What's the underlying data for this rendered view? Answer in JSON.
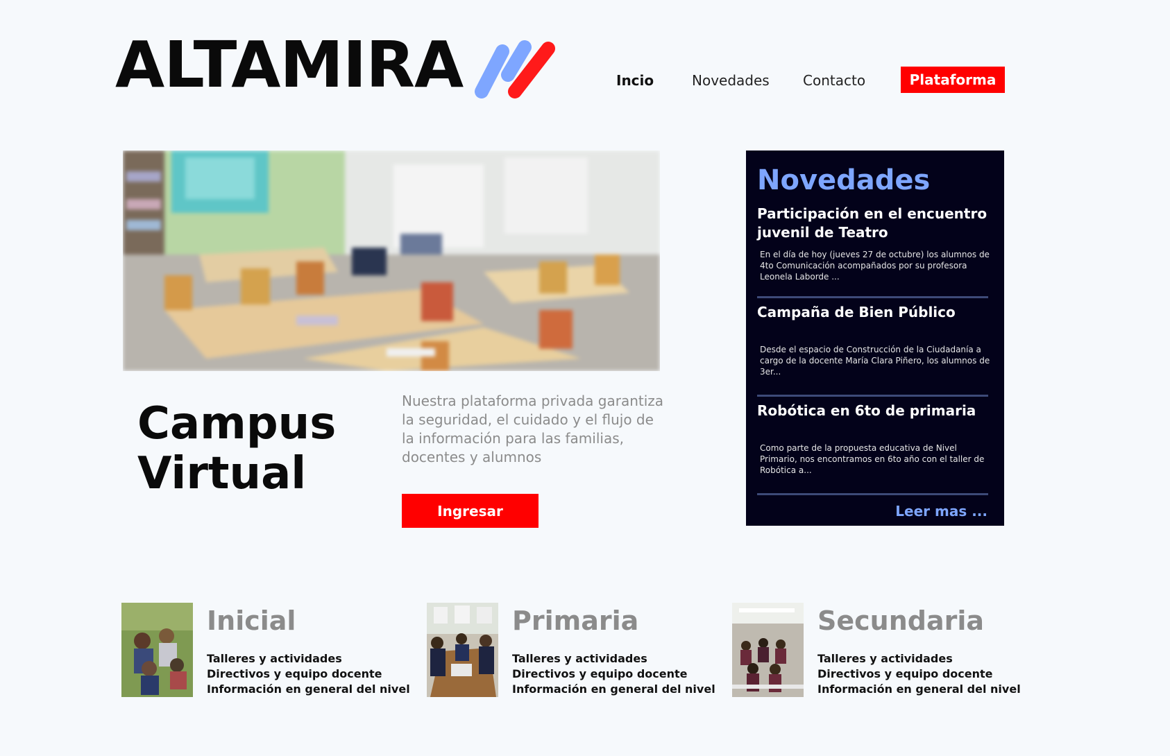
{
  "header": {
    "brand": "ALTAMIRA",
    "nav": [
      "Incio",
      "Novedades",
      "Contacto"
    ],
    "platform_button": "Plataforma"
  },
  "hero": {
    "title_line1": "Campus",
    "title_line2": "Virtual",
    "description": "Nuestra plataforma privada garantiza la seguridad, el cuidado y el flujo de la información para las familias, docentes y alumnos",
    "cta": "Ingresar"
  },
  "news": {
    "title": "Novedades",
    "items": [
      {
        "title": "Participación en el encuentro juvenil de Teatro",
        "excerpt": "En el día de hoy (jueves 27 de octubre) los alumnos de 4to Comunicación acompañados por su profesora Leonela Laborde ..."
      },
      {
        "title": "Campaña de Bien Público",
        "excerpt": "Desde el espacio de Construcción de la Ciudadanía a cargo de la docente María Clara Piñero, los alumnos de 3er..."
      },
      {
        "title": "Robótica en 6to de primaria",
        "excerpt": "Como parte de la propuesta educativa de Nivel Primario, nos encontramos en 6to año con el taller de Robótica a..."
      }
    ],
    "more": "Leer mas ..."
  },
  "levels": [
    {
      "title": "Inicial",
      "links": [
        "Talleres y actividades",
        "Directivos y equipo docente",
        "Información en general del nivel"
      ]
    },
    {
      "title": "Primaria",
      "links": [
        "Talleres y actividades",
        "Directivos y equipo docente",
        "Información en general del nivel"
      ]
    },
    {
      "title": "Secundaria",
      "links": [
        "Talleres y actividades",
        "Directivos y equipo docente",
        "Información en general del nivel"
      ]
    }
  ],
  "colors": {
    "accent_red": "#ff0000",
    "news_bg": "#03021a",
    "news_title": "#7ea6ff",
    "logo_blue": "#7ea6ff"
  }
}
